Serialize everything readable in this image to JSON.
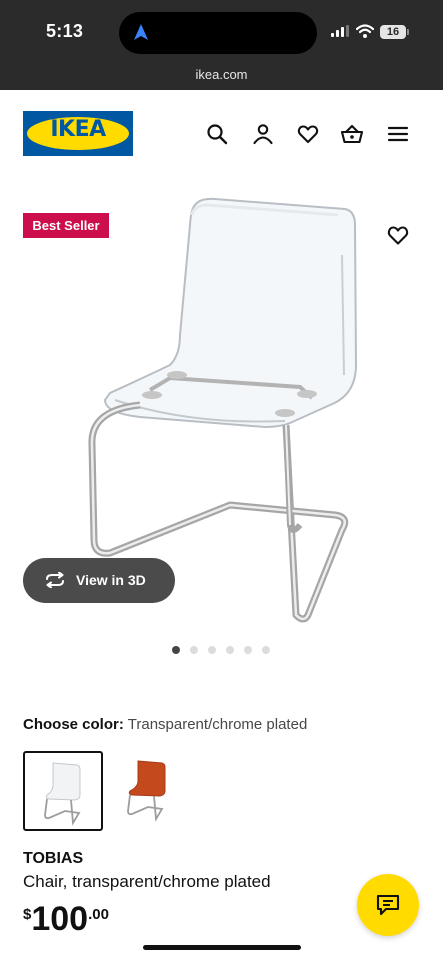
{
  "status_bar": {
    "time": "5:13",
    "battery": "16",
    "icons": [
      "location-arrow-icon",
      "signal-icon",
      "wifi-icon",
      "battery-icon"
    ]
  },
  "browser": {
    "url": "ikea.com"
  },
  "header": {
    "logo_text": "IKEA",
    "icons": [
      "search-icon",
      "account-icon",
      "wishlist-heart-icon",
      "shopping-basket-icon",
      "menu-icon"
    ],
    "brand_blue": "#0058a3",
    "brand_yellow": "#ffdb00"
  },
  "product_media": {
    "badge": "Best Seller",
    "badge_color": "#cc0f4c",
    "view_3d_label": "View in 3D",
    "carousel": {
      "total": 6,
      "active": 0
    }
  },
  "color_choice": {
    "label": "Choose color:",
    "value": "Transparent/chrome plated",
    "options": [
      {
        "name": "transparent-chrome",
        "selected": true
      },
      {
        "name": "orange",
        "selected": false
      }
    ]
  },
  "product": {
    "name": "TOBIAS",
    "description": "Chair, transparent/chrome plated",
    "price_currency": "$",
    "price_integer": "100",
    "price_decimal": ".00"
  },
  "chat_button": {
    "icon": "chat-icon"
  }
}
